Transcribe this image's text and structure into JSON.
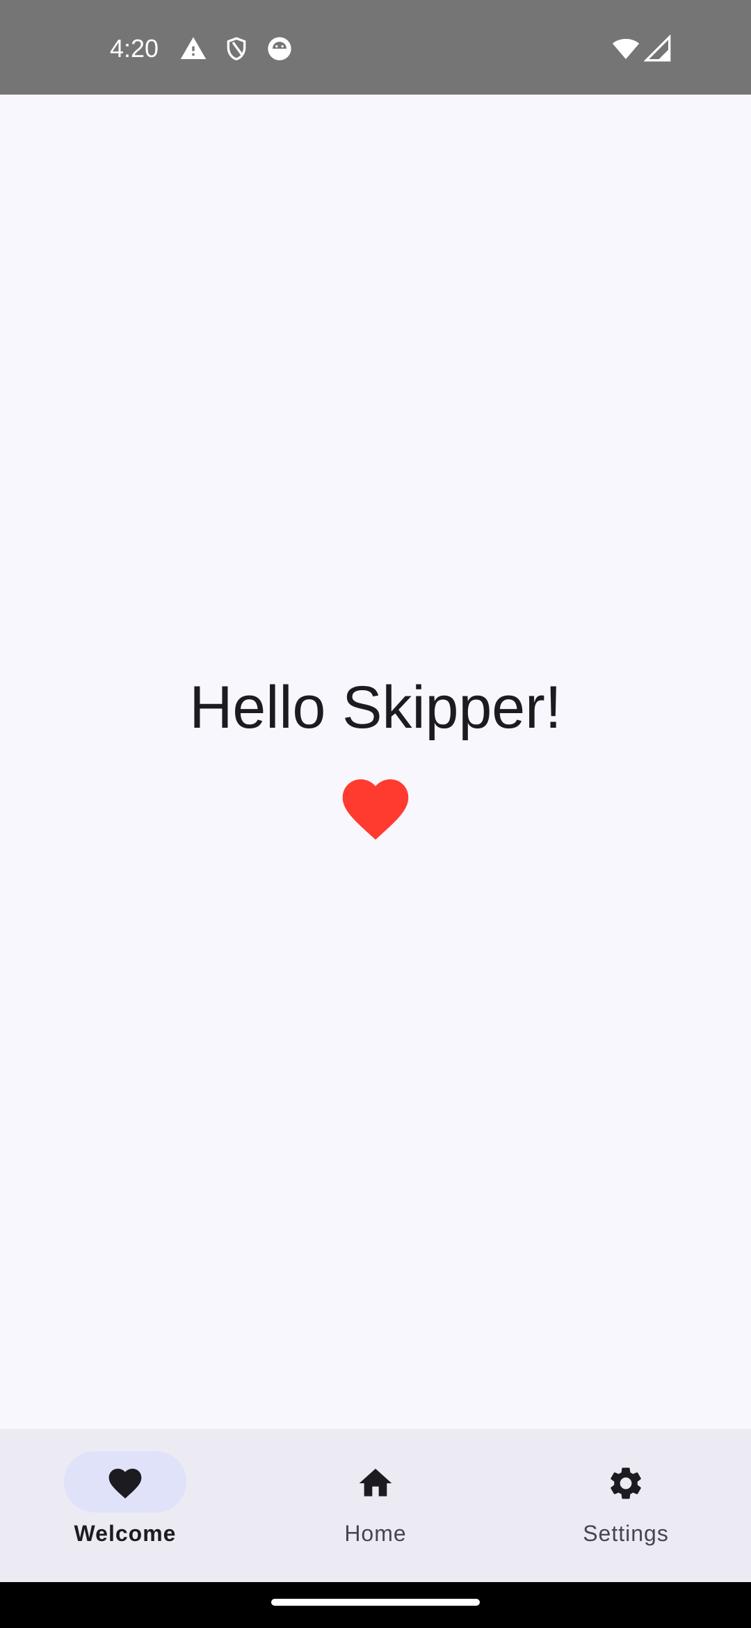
{
  "status_bar": {
    "time": "4:20",
    "left_icons": [
      "warning-icon",
      "shield-icon",
      "android-debug-icon"
    ],
    "right_icons": [
      "wifi-icon",
      "cell-signal-icon"
    ],
    "background": "#757575"
  },
  "main": {
    "greeting": "Hello Skipper!",
    "heart_icon": "heart-icon",
    "heart_color": "#ff3b30",
    "background": "#f8f7fd"
  },
  "bottom_nav": {
    "items": [
      {
        "label": "Welcome",
        "icon": "heart-icon",
        "selected": true
      },
      {
        "label": "Home",
        "icon": "home-icon",
        "selected": false
      },
      {
        "label": "Settings",
        "icon": "gear-icon",
        "selected": false
      }
    ],
    "background": "#ecebf4",
    "indicator_color": "#dfe2f9"
  }
}
